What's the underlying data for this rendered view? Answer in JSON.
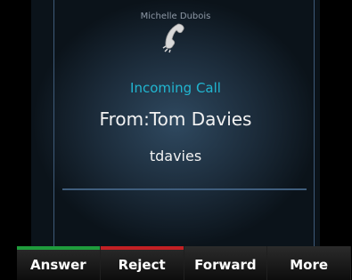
{
  "call": {
    "user_name": "Michelle Dubois",
    "title": "Incoming Call",
    "from_label": "From:Tom Davies",
    "account": "tdavies"
  },
  "softkeys": [
    {
      "label": "Answer",
      "accent_color": "#1f9c3c"
    },
    {
      "label": "Reject",
      "accent_color": "#c22024"
    },
    {
      "label": "Forward",
      "accent_color": ""
    },
    {
      "label": "More",
      "accent_color": ""
    }
  ],
  "colors": {
    "title": "#21b6d1",
    "answer_accent": "#1f9c3c",
    "reject_accent": "#c22024"
  },
  "icons": {
    "handset": "handset-icon"
  }
}
